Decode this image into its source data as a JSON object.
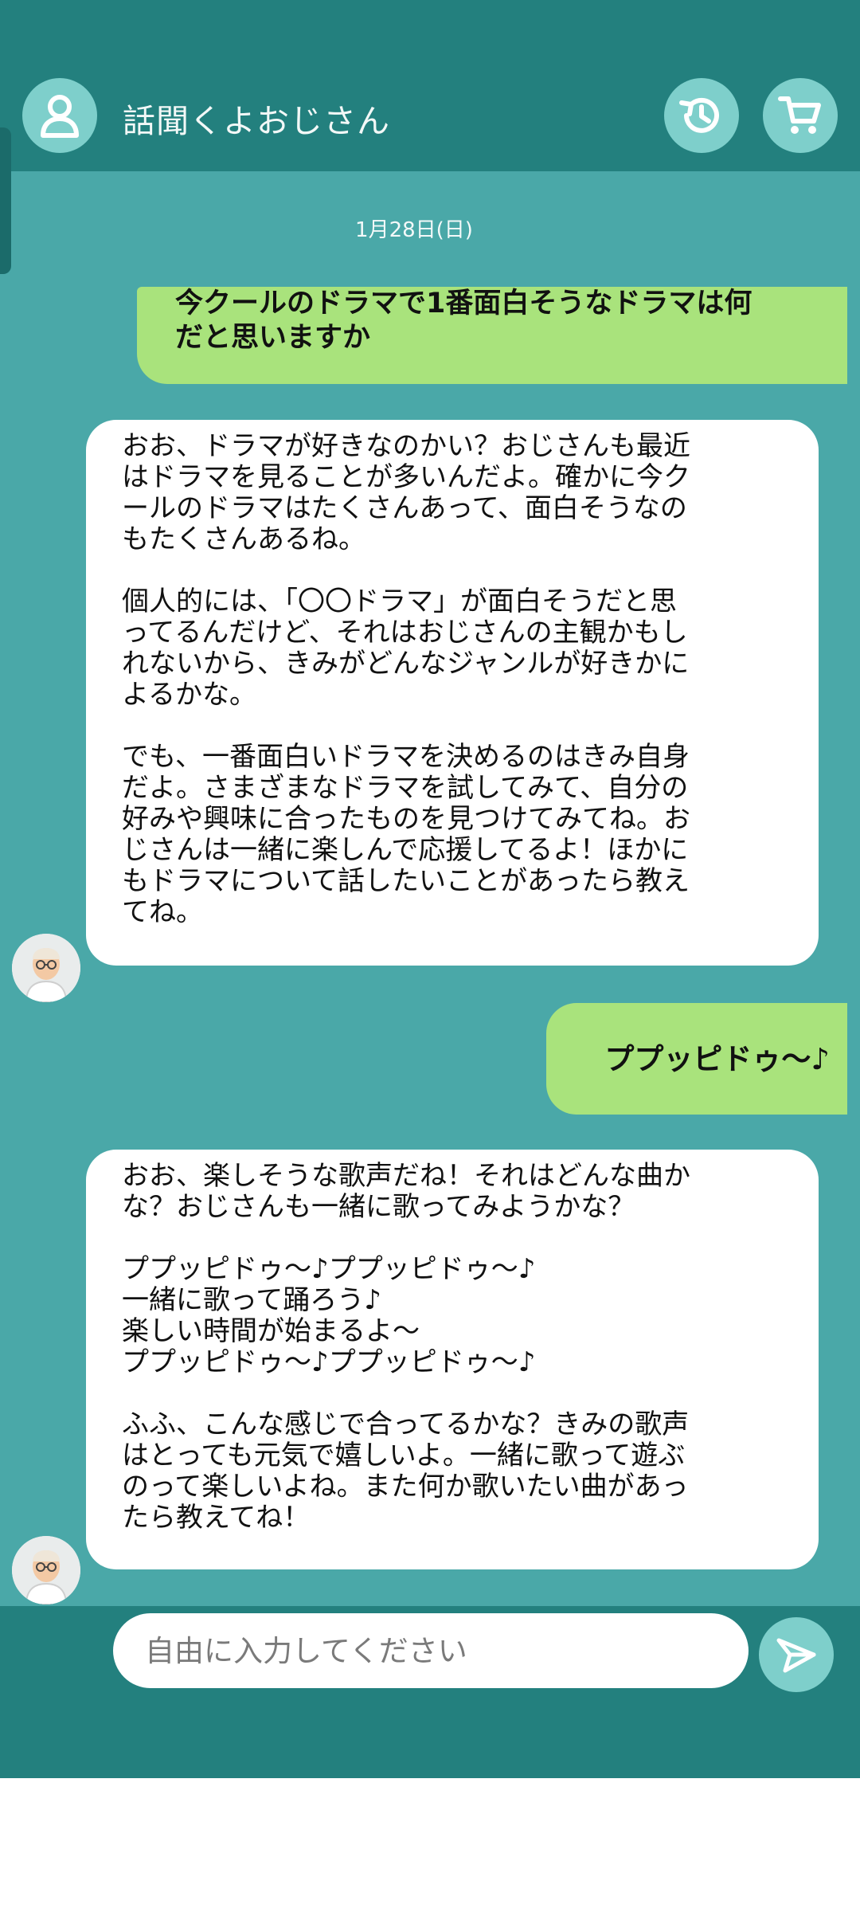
{
  "header": {
    "title": "話聞くよおじさん",
    "profile_icon": "user-icon",
    "history_icon": "history-icon",
    "cart_icon": "cart-icon"
  },
  "chat": {
    "date": "1月28日(日)",
    "messages": [
      {
        "role": "user",
        "text": "今クールのドラマで1番面白そうなドラマは何\nだと思いますか"
      },
      {
        "role": "bot",
        "paragraphs": [
          "おお、ドラマが好きなのかい？おじさんも最近\nはドラマを見ることが多いんだよ。確かに今ク\nールのドラマはたくさんあって、面白そうなの\nもたくさんあるね。",
          "個人的には、「〇〇ドラマ」が面白そうだと思\nってるんだけど、それはおじさんの主観かもし\nれないから、きみがどんなジャンルが好きかに\nよるかな。",
          "でも、一番面白いドラマを決めるのはきみ自身\nだよ。さまざまなドラマを試してみて、自分の\n好みや興味に合ったものを見つけてみてね。お\nじさんは一緒に楽しんで応援してるよ！ほかに\nもドラマについて話したいことがあったら教え\nてね。"
        ]
      },
      {
        "role": "user",
        "text": "ププッピドゥ〜♪"
      },
      {
        "role": "bot",
        "paragraphs": [
          "おお、楽しそうな歌声だね！それはどんな曲か\nな？おじさんも一緒に歌ってみようかな？",
          "ププッピドゥ〜♪ププッピドゥ〜♪\n一緒に歌って踊ろう♪\n楽しい時間が始まるよ〜\nププッピドゥ〜♪ププッピドゥ〜♪",
          "ふふ、こんな感じで合ってるかな？きみの歌声\nはとっても元気で嬉しいよ。一緒に歌って遊ぶ\nのって楽しいよね。また何か歌いたい曲があっ\nたら教えてね！"
        ]
      }
    ]
  },
  "composer": {
    "placeholder": "自由に入力してください",
    "send_icon": "send-icon"
  },
  "colors": {
    "header_bg": "#23807e",
    "chat_bg": "#4aa8a8",
    "user_bubble": "#a9e37c",
    "bot_bubble": "#ffffff",
    "button_bg": "#7ecfcb"
  }
}
